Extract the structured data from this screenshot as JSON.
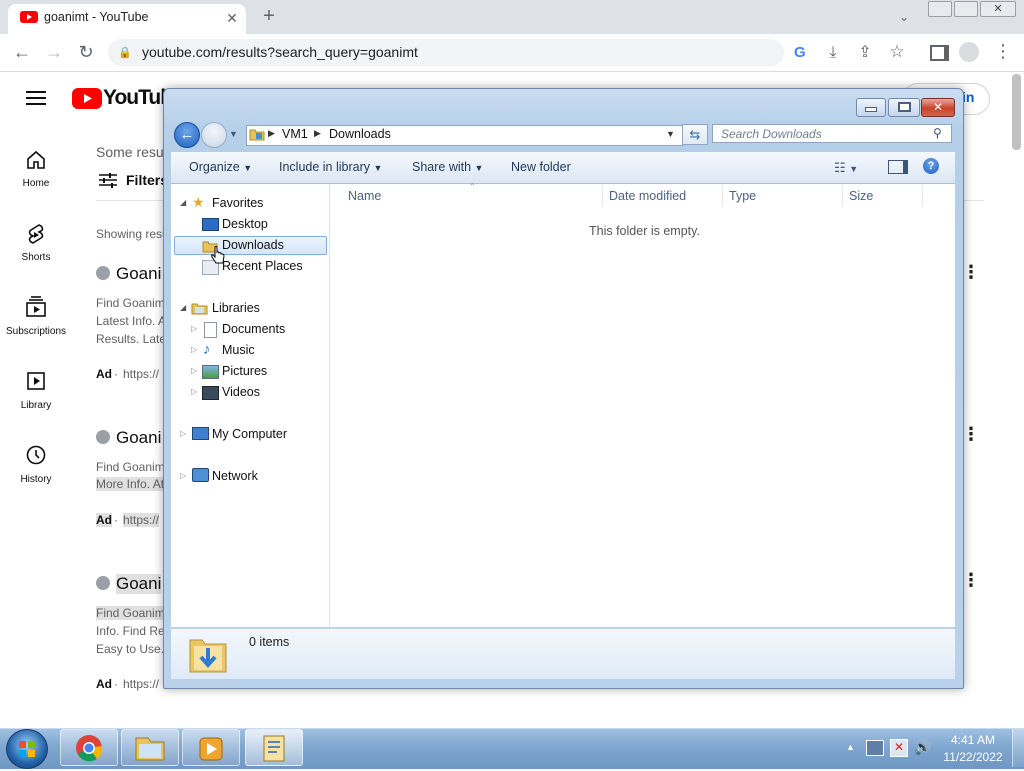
{
  "browser": {
    "tab_title": "goanimt - YouTube",
    "url": "youtube.com/results?search_query=goanimt"
  },
  "youtube": {
    "logo_text": "YouTube",
    "sign_in_partial": "in",
    "sidebar": [
      {
        "label": "Home",
        "icon": "home-icon"
      },
      {
        "label": "Shorts",
        "icon": "shorts-icon"
      },
      {
        "label": "Subscriptions",
        "icon": "subscriptions-icon"
      },
      {
        "label": "Library",
        "icon": "library-icon"
      },
      {
        "label": "History",
        "icon": "history-icon"
      }
    ],
    "some_results": "Some resu",
    "filters": "Filters",
    "showing_results": "Showing resu",
    "results": [
      {
        "title": "Goani",
        "line1": "Find Goanim",
        "line2": "Latest Info. A",
        "line3": "Results. Late",
        "ad": "Ad",
        "url": "https://"
      },
      {
        "title": "Goani",
        "line1": "Find Goanim",
        "line2": "More Info. At",
        "ad": "Ad",
        "url": "https://"
      },
      {
        "title": "Goani",
        "line1": "Find Goanim",
        "line2": "Info. Find Re",
        "line3": "Easy to Use.",
        "ad": "Ad",
        "url": "https://"
      }
    ]
  },
  "explorer": {
    "breadcrumb": [
      "VM1",
      "Downloads"
    ],
    "search_placeholder": "Search Downloads",
    "commands": {
      "organize": "Organize",
      "include": "Include in library",
      "share": "Share with",
      "new_folder": "New folder"
    },
    "nav": {
      "favorites": "Favorites",
      "desktop": "Desktop",
      "downloads": "Downloads",
      "recent": "Recent Places",
      "libraries": "Libraries",
      "documents": "Documents",
      "music": "Music",
      "pictures": "Pictures",
      "videos": "Videos",
      "computer": "My Computer",
      "network": "Network"
    },
    "columns": {
      "name": "Name",
      "date": "Date modified",
      "type": "Type",
      "size": "Size"
    },
    "empty_message": "This folder is empty.",
    "status": "0 items"
  },
  "taskbar": {
    "time": "4:41 AM",
    "date": "11/22/2022"
  }
}
